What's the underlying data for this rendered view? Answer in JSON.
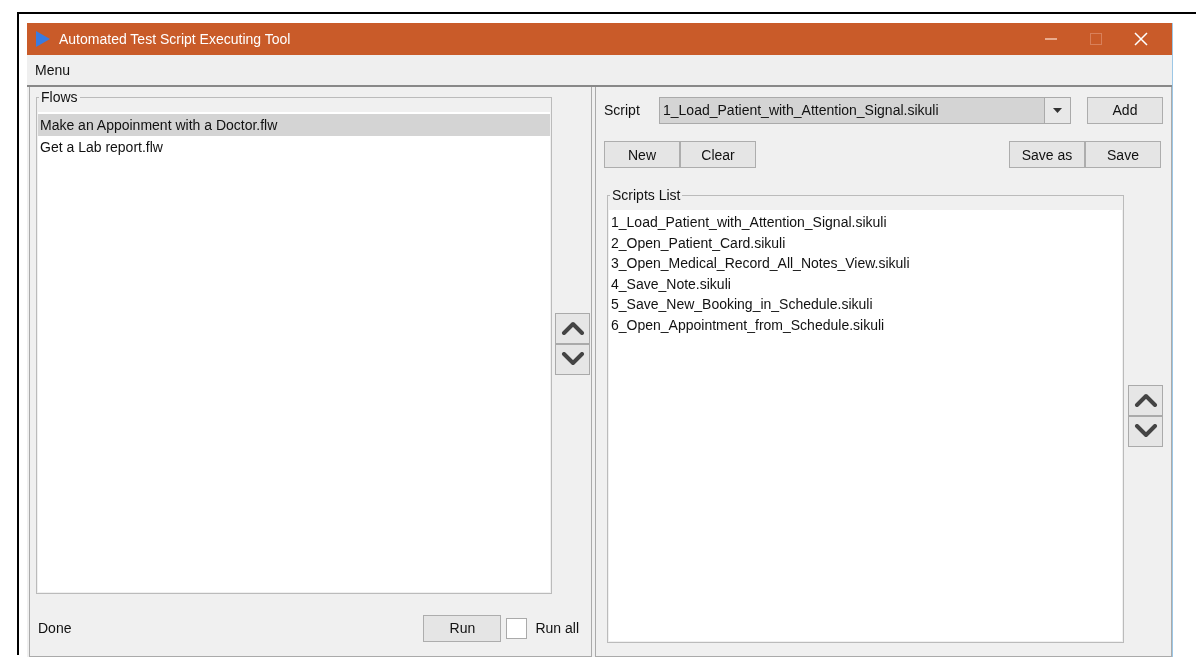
{
  "window": {
    "title": "Automated Test Script Executing Tool"
  },
  "menu": [
    "Menu"
  ],
  "flows": {
    "label": "Flows",
    "items": [
      {
        "label": "Make an Appoinment with a Doctor.flw",
        "selected": true
      },
      {
        "label": "Get a Lab report.flw",
        "selected": false
      }
    ]
  },
  "status": "Done",
  "run_button": "Run",
  "run_all": {
    "label": "Run all",
    "checked": false
  },
  "script": {
    "label": "Script",
    "value": "1_Load_Patient_with_Attention_Signal.sikuli",
    "add_button": "Add"
  },
  "left_buttons": [
    "New",
    "Clear"
  ],
  "right_buttons": [
    "Save as",
    "Save"
  ],
  "scripts_list": {
    "label": "Scripts List",
    "items": [
      {
        "label": "1_Load_Patient_with_Attention_Signal.sikuli",
        "selected": false
      },
      {
        "label": "2_Open_Patient_Card.sikuli",
        "selected": false
      },
      {
        "label": "3_Open_Medical_Record_All_Notes_View.sikuli",
        "selected": false
      },
      {
        "label": "4_Save_Note.sikuli",
        "selected": false
      },
      {
        "label": "5_Save_New_Booking_in_Schedule.sikuli",
        "selected": false
      },
      {
        "label": "6_Open_Appointment_from_Schedule.sikuli",
        "selected": false
      }
    ]
  }
}
